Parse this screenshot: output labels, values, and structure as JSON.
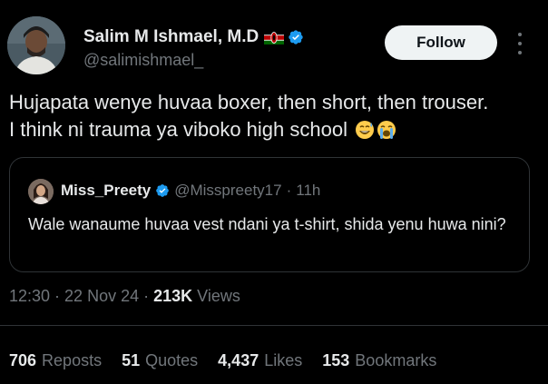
{
  "author": {
    "name": "Salim M Ishmael, M.D",
    "handle": "@salimishmael_",
    "flag_icon": "kenya-flag-icon",
    "verified_icon": "verified-badge-icon"
  },
  "actions": {
    "follow_label": "Follow",
    "more_icon": "more-vertical-icon"
  },
  "tweet": {
    "line1": "Hujapata wenye huvaa boxer, then short, then trouser.",
    "line2": "I think ni trauma ya viboko high school",
    "emojis": [
      "grinning-sweat-emoji",
      "loudly-crying-emoji"
    ]
  },
  "quoted": {
    "name": "Miss_Preety",
    "handle": "@Misspreety17",
    "separator": "·",
    "time": "11h",
    "text": "Wale wanaume huvaa vest ndani ya t-shirt, shida yenu huwa nini?"
  },
  "meta": {
    "time": "12:30",
    "sep1": "·",
    "date": "22 Nov 24",
    "sep2": "·",
    "views_count": "213K",
    "views_label": "Views"
  },
  "stats": [
    {
      "count": "706",
      "label": "Reposts"
    },
    {
      "count": "51",
      "label": "Quotes"
    },
    {
      "count": "4,437",
      "label": "Likes"
    },
    {
      "count": "153",
      "label": "Bookmarks"
    }
  ],
  "colors": {
    "background": "#000000",
    "text_primary": "#e7e9ea",
    "text_secondary": "#71767b",
    "verified_blue": "#1d9bf0",
    "border": "#2f3336",
    "follow_bg": "#eff3f4"
  }
}
